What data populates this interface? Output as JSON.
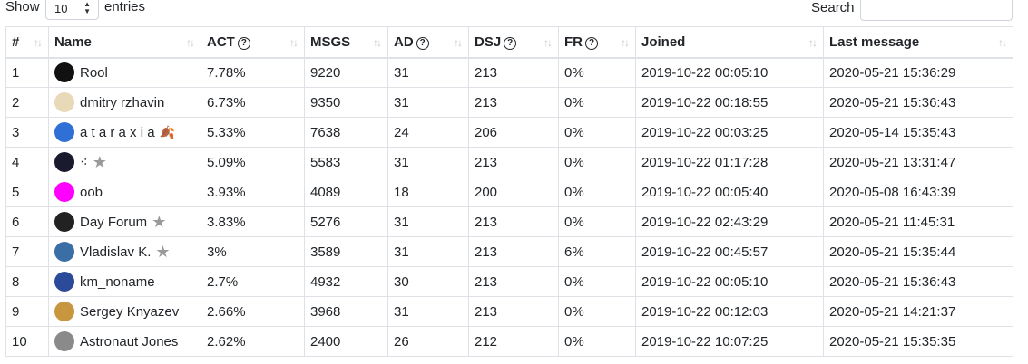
{
  "controls": {
    "show_label": "Show",
    "entries_value": "10",
    "entries_label": "entries",
    "search_label": "Search",
    "search_value": ""
  },
  "columns": [
    {
      "label": "#",
      "help": false
    },
    {
      "label": "Name",
      "help": false
    },
    {
      "label": "ACT",
      "help": true
    },
    {
      "label": "MSGS",
      "help": false
    },
    {
      "label": "AD",
      "help": true
    },
    {
      "label": "DSJ",
      "help": true
    },
    {
      "label": "FR",
      "help": true
    },
    {
      "label": "Joined",
      "help": false
    },
    {
      "label": "Last message",
      "help": false
    }
  ],
  "rows": [
    {
      "n": "1",
      "name": "Rool",
      "act": "7.78%",
      "msgs": "9220",
      "ad": "31",
      "dsj": "213",
      "fr": "0%",
      "joined": "2019-10-22 00:05:10",
      "last": "2020-05-21 15:36:29",
      "avatar_color": "#111111",
      "badge": ""
    },
    {
      "n": "2",
      "name": "dmitry rzhavin",
      "act": "6.73%",
      "msgs": "9350",
      "ad": "31",
      "dsj": "213",
      "fr": "0%",
      "joined": "2019-10-22 00:18:55",
      "last": "2020-05-21 15:36:43",
      "avatar_color": "#e8d9b8",
      "badge": ""
    },
    {
      "n": "3",
      "name": "a t a r a x i a",
      "act": "5.33%",
      "msgs": "7638",
      "ad": "24",
      "dsj": "206",
      "fr": "0%",
      "joined": "2019-10-22 00:03:25",
      "last": "2020-05-14 15:35:43",
      "avatar_color": "#2f6fd6",
      "badge": "leaf-icon"
    },
    {
      "n": "4",
      "name": "⁖",
      "act": "5.09%",
      "msgs": "5583",
      "ad": "31",
      "dsj": "213",
      "fr": "0%",
      "joined": "2019-10-22 01:17:28",
      "last": "2020-05-21 13:31:47",
      "avatar_color": "#1a1a2e",
      "badge": "star-icon"
    },
    {
      "n": "5",
      "name": "oob",
      "act": "3.93%",
      "msgs": "4089",
      "ad": "18",
      "dsj": "200",
      "fr": "0%",
      "joined": "2019-10-22 00:05:40",
      "last": "2020-05-08 16:43:39",
      "avatar_color": "#ff00ff",
      "badge": ""
    },
    {
      "n": "6",
      "name": "Day Forum",
      "act": "3.83%",
      "msgs": "5276",
      "ad": "31",
      "dsj": "213",
      "fr": "0%",
      "joined": "2019-10-22 02:43:29",
      "last": "2020-05-21 11:45:31",
      "avatar_color": "#222222",
      "badge": "star-icon"
    },
    {
      "n": "7",
      "name": "Vladislav K.",
      "act": "3%",
      "msgs": "3589",
      "ad": "31",
      "dsj": "213",
      "fr": "6%",
      "joined": "2019-10-22 00:45:57",
      "last": "2020-05-21 15:35:44",
      "avatar_color": "#3a6ea5",
      "badge": "star-icon"
    },
    {
      "n": "8",
      "name": "km_noname",
      "act": "2.7%",
      "msgs": "4932",
      "ad": "30",
      "dsj": "213",
      "fr": "0%",
      "joined": "2019-10-22 00:05:10",
      "last": "2020-05-21 15:36:43",
      "avatar_color": "#2c4a9a",
      "badge": ""
    },
    {
      "n": "9",
      "name": "Sergey Knyazev",
      "act": "2.66%",
      "msgs": "3968",
      "ad": "31",
      "dsj": "213",
      "fr": "0%",
      "joined": "2019-10-22 00:12:03",
      "last": "2020-05-21 14:21:37",
      "avatar_color": "#c8963e",
      "badge": ""
    },
    {
      "n": "10",
      "name": "Astronaut Jones",
      "act": "2.62%",
      "msgs": "2400",
      "ad": "26",
      "dsj": "212",
      "fr": "0%",
      "joined": "2019-10-22 10:07:25",
      "last": "2020-05-21 15:35:35",
      "avatar_color": "#8a8a8a",
      "badge": ""
    }
  ]
}
